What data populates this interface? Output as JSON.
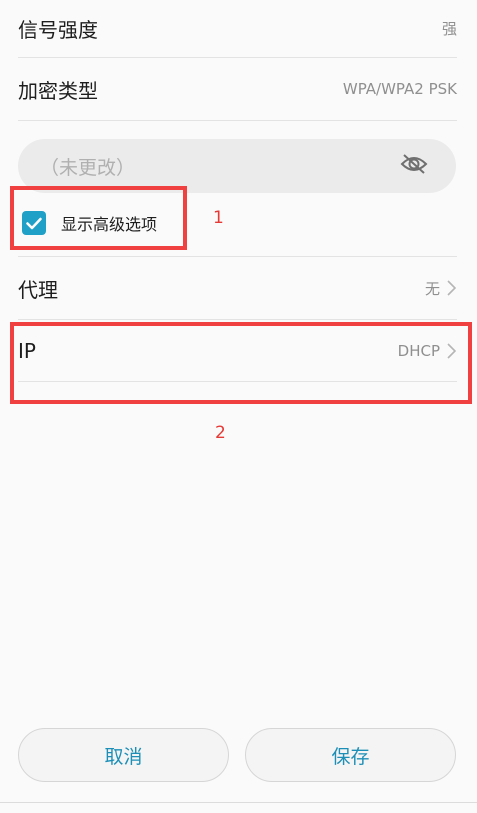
{
  "signal": {
    "label": "信号强度",
    "value": "强"
  },
  "encryption": {
    "label": "加密类型",
    "value": "WPA/WPA2 PSK"
  },
  "password": {
    "placeholder": "（未更改）"
  },
  "advanced": {
    "label": "显示高级选项",
    "checked": true
  },
  "proxy": {
    "label": "代理",
    "value": "无"
  },
  "ip": {
    "label": "IP",
    "value": "DHCP"
  },
  "annotations": {
    "one": "1",
    "two": "2"
  },
  "buttons": {
    "cancel": "取消",
    "save": "保存"
  },
  "colors": {
    "accent": "#1fa0c7",
    "button_text": "#1d8fb6",
    "annotation": "#f04040"
  }
}
